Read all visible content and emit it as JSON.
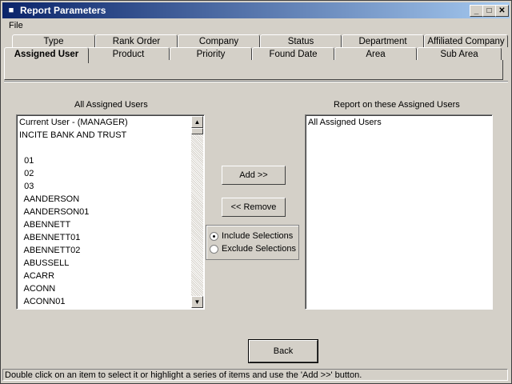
{
  "window": {
    "title": "Report Parameters"
  },
  "menu": {
    "file": "File"
  },
  "tabs_row1": [
    "Type",
    "Rank Order",
    "Company",
    "Status",
    "Department",
    "Affiliated Company"
  ],
  "tabs_row2": [
    "Assigned User",
    "Product",
    "Priority",
    "Found Date",
    "Area",
    "Sub Area"
  ],
  "active_tab": "Assigned User",
  "left_list": {
    "label": "All Assigned Users",
    "items": [
      "Current User - (MANAGER)",
      "INCITE BANK AND TRUST",
      "",
      "  01",
      "  02",
      "  03",
      "  AANDERSON",
      "  AANDERSON01",
      "  ABENNETT",
      "  ABENNETT01",
      "  ABENNETT02",
      "  ABUSSELL",
      "  ACARR",
      "  ACONN",
      "  ACONN01"
    ]
  },
  "right_list": {
    "label": "Report on these Assigned Users",
    "items": [
      "All Assigned Users"
    ]
  },
  "buttons": {
    "add": "Add >>",
    "remove": "<< Remove",
    "back": "Back"
  },
  "options": {
    "include": "Include Selections",
    "exclude": "Exclude Selections",
    "selected": "include"
  },
  "status": "Double click on an item to select it or highlight a series of items and use the 'Add >>' button."
}
